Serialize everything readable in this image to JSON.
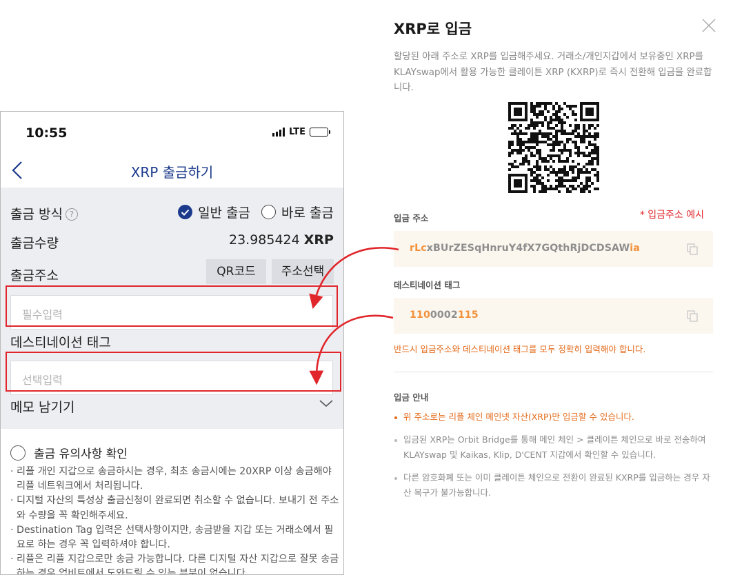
{
  "phone": {
    "status": {
      "time": "10:55",
      "network": "LTE"
    },
    "nav": {
      "title": "XRP 출금하기"
    },
    "method": {
      "label": "출금 방식",
      "help": "?",
      "option_normal": "일반 출금",
      "option_instant": "바로 출금",
      "selected": "일반 출금"
    },
    "amount": {
      "label": "출금수량",
      "value": "23.985424",
      "unit": "XRP"
    },
    "address": {
      "label": "출금주소",
      "qr_button": "QR코드",
      "select_button": "주소선택",
      "placeholder": "필수입력"
    },
    "dest_tag": {
      "label": "데스티네이션 태그",
      "placeholder": "선택입력"
    },
    "memo": {
      "label": "메모 남기기"
    },
    "notice": {
      "title": "출금 유의사항 확인",
      "items": [
        "· 리플 개인 지갑으로 송금하시는 경우, 최초 송금시에는 20XRP 이상 송금해야 리플 네트워크에서 처리됩니다.",
        "· 디지털 자산의 특성상 출금신청이 완료되면 취소할 수 없습니다. 보내기 전 주소와 수량을 꼭 확인해주세요.",
        "· Destination Tag 입력은 선택사항이지만, 송금받을 지갑 또는 거래소에서 필요로 하는 경우 꼭 입력하셔야 합니다.",
        "· 리플은 리플 지갑으로만 송금 가능합니다. 다른 디지털 자산 지갑으로 잘못 송금하는 경우 업비트에서 도와드릴 수 있는 부분이 없습니다."
      ]
    }
  },
  "dialog": {
    "title": "XRP로 입금",
    "description": "할당된 아래 주소로 XRP를 입금해주세요. 거래소/개인지갑에서 보유중인 XRP를 KLAYswap에서 활용 가능한 클레이튼 XRP (KXRP)로 즉시 전환해 입금을 완료합니다.",
    "address_label": "입금 주소",
    "example_note": "* 입금주소 예시",
    "address": {
      "prefix": "rLc",
      "middle": "xBUrZESqHnruY4fX7GQthRjDCDSAW",
      "suffix": "ia"
    },
    "tag_label": "데스티네이션 태그",
    "tag": {
      "prefix": "110",
      "middle": "0002",
      "suffix": "115"
    },
    "warning": "반드시 입금주소와 데스티네이션 태그를 모두 정확히 입력해야 합니다.",
    "guide_title": "입금 안내",
    "guide_items": [
      "위 주소로는 리플 체인 메인넷 자산(XRP)만 입금할 수 있습니다.",
      "입금된 XRP는 Orbit Bridge를 통해 메인 체인 > 클레이튼 체인으로 바로 전송하여 KLAYswap 및 Kaikas, Klip, D'CENT 지갑에서 확인할 수 있습니다.",
      "다른 암호화폐 또는 이미 클레이튼 체인으로 전환이 완료된 KXRP를 입금하는 경우 자산 복구가 불가능합니다."
    ]
  },
  "colors": {
    "brand_navy": "#1b3a8c",
    "highlight_red": "#e0262b",
    "accent_orange": "#e36a1a",
    "value_box": "#fbf6ee"
  },
  "icons": [
    "signal-icon",
    "battery-icon",
    "back-icon",
    "help-icon",
    "radio-checked-icon",
    "radio-unchecked-icon",
    "chevron-down-icon",
    "close-icon",
    "qr-code",
    "copy-icon",
    "arrow-icon"
  ]
}
